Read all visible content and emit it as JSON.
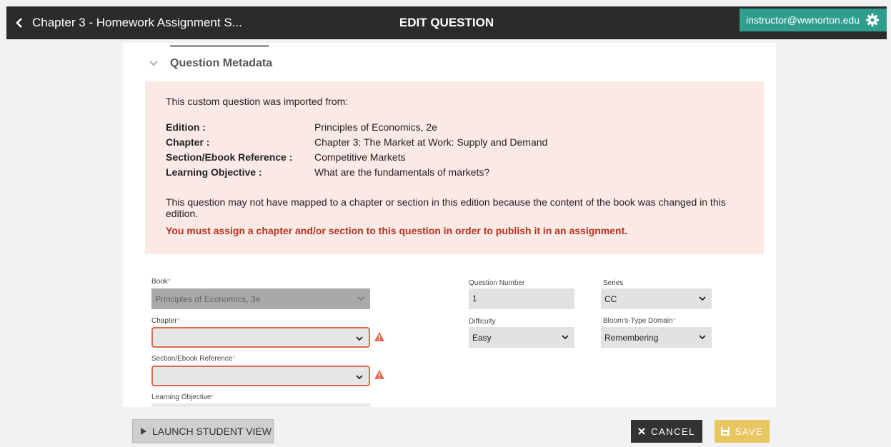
{
  "header": {
    "back_label": "Chapter 3 - Homework Assignment S...",
    "title": "EDIT QUESTION",
    "user_email": "instructor@wwnorton.edu"
  },
  "metadata_section": {
    "title": "Question Metadata",
    "notice": {
      "intro": "This custom question was imported from:",
      "fields": [
        {
          "label": "Edition :",
          "value": "Principles of Economics, 2e"
        },
        {
          "label": "Chapter :",
          "value": "Chapter 3: The Market at Work: Supply and Demand"
        },
        {
          "label": "Section/Ebook Reference :",
          "value": "Competitive Markets"
        },
        {
          "label": "Learning Objective :",
          "value": "What are the fundamentals of markets?"
        }
      ],
      "body": "This question may not have mapped to a chapter or section in this edition because the content of the book was changed in this edition.",
      "warning": "You must assign a chapter and/or section to this question in order to publish it in an assignment."
    }
  },
  "form": {
    "book": {
      "label": "Book",
      "required_mark": "*",
      "value": "Principles of Economics, 3e"
    },
    "chapter": {
      "label": "Chapter",
      "required_mark": "*",
      "value": ""
    },
    "section": {
      "label": "Section/Ebook Reference",
      "required_mark": "*",
      "value": ""
    },
    "learning_objective": {
      "label": "Learning Objective",
      "required_mark": "*"
    },
    "question_number": {
      "label": "Question Number",
      "value": "1"
    },
    "series": {
      "label": "Series",
      "value": "CC"
    },
    "difficulty": {
      "label": "Difficulty",
      "value": "Easy"
    },
    "blooms": {
      "label": "Bloom's-Type Domain",
      "required_mark": "*",
      "value": "Remembering"
    }
  },
  "footer": {
    "launch_label": "LAUNCH STUDENT VIEW",
    "cancel_label": "CANCEL",
    "save_label": "SAVE"
  },
  "colors": {
    "topbar": "#2b2b2b",
    "user_badge": "#2f9e8f",
    "notice_bg": "#fbe9e6",
    "warning_text": "#b5321e",
    "error_border": "#e0694f",
    "save_button": "#e8c660",
    "cancel_button": "#333333"
  },
  "icons": [
    "chevron-left-icon",
    "gear-icon",
    "chevron-down-icon",
    "warning-triangle-icon",
    "play-triangle-icon",
    "close-x-icon",
    "save-icon"
  ]
}
